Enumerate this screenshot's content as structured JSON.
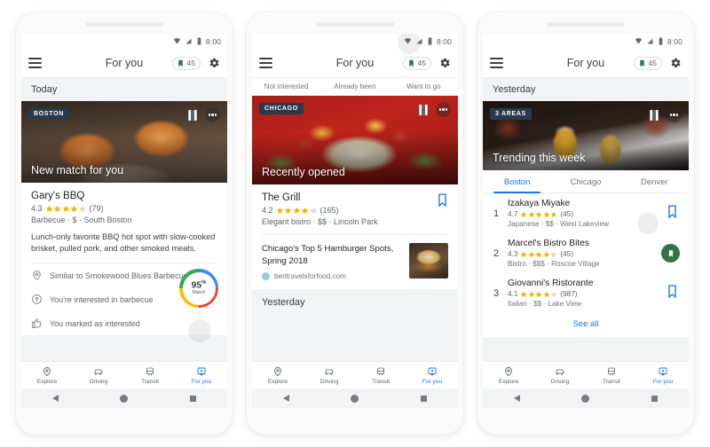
{
  "statusbar": {
    "time": "8:00",
    "icons": [
      "wifi-icon",
      "signal-icon",
      "battery-icon"
    ]
  },
  "appbar": {
    "title": "For you",
    "menu_icon": "hamburger-menu-icon",
    "saved_count": "45",
    "saved_icon": "bookmark-icon",
    "settings_icon": "gear-icon"
  },
  "colors": {
    "accent_blue": "#1a73e8",
    "saved_green": "#34734a",
    "chip_navy": "#2a3a4d",
    "star_gold": "#f5b400",
    "strip_gray": "#f1f3f4"
  },
  "bottom_nav": {
    "items": [
      {
        "label": "Explore",
        "icon": "explore-pin-icon",
        "active": false
      },
      {
        "label": "Driving",
        "icon": "car-icon",
        "active": false
      },
      {
        "label": "Transit",
        "icon": "train-icon",
        "active": false
      },
      {
        "label": "For you",
        "icon": "for-you-icon",
        "active": true
      }
    ]
  },
  "system_bar": {
    "back": "back-triangle-icon",
    "home": "home-circle-icon",
    "recents": "recents-square-icon"
  },
  "phone1": {
    "section_label": "Today",
    "hero": {
      "city_chip": "BOSTON",
      "title": "New match for you",
      "photo": "bbq-sandwiches-photo",
      "map_icon": "map-badge-icon",
      "overflow_icon": "more-options-icon"
    },
    "place": {
      "name": "Gary's BBQ",
      "rating": "4.3",
      "stars": 4.3,
      "review_count": "(79)",
      "meta": "Barbecue · $ · South Boston",
      "description": "Lunch-only favorite BBQ hot spot with slow-cooked brisket, pulled pork, and other smoked meats."
    },
    "reasons": [
      {
        "icon": "place-pin-icon",
        "text": "Similar to Smokewood Blues Barbecue"
      },
      {
        "icon": "interest-arrow-icon",
        "text": "You're interested in barbecue"
      },
      {
        "icon": "thumbs-up-icon",
        "text": "You marked as interested"
      }
    ],
    "match": {
      "percent": "95",
      "percent_symbol": "%",
      "label": "Match"
    }
  },
  "phone2": {
    "filters": [
      "Not interested",
      "Already been",
      "Want to go"
    ],
    "hero": {
      "city_chip": "CHICAGO",
      "title": "Recently opened",
      "photo": "grilled-chicken-salad-photo",
      "map_icon": "map-badge-icon",
      "overflow_icon": "more-options-icon"
    },
    "place": {
      "name": "The Grill",
      "rating": "4.2",
      "stars": 4.2,
      "review_count": "(165)",
      "meta": "Elegant bistro · $$ · Lincoln Park",
      "bookmark_icon": "bookmark-outline-icon"
    },
    "article": {
      "title": "Chicago's Top 5 Hamburger Spots, Spring 2018",
      "domain": "bentravelsforfood.com",
      "thumbnail": "hamburger-thumbnail",
      "favicon": "site-favicon"
    },
    "next_section_label": "Yesterday"
  },
  "phone3": {
    "section_label": "Yesterday",
    "hero": {
      "city_chip": "3 AREAS",
      "title": "Trending this week",
      "photo": "beer-cheers-photo",
      "map_icon": "map-badge-icon",
      "overflow_icon": "more-options-icon"
    },
    "tabs": [
      {
        "label": "Boston",
        "active": true
      },
      {
        "label": "Chicago",
        "active": false
      },
      {
        "label": "Denver",
        "active": false
      }
    ],
    "list": [
      {
        "rank": "1",
        "name": "Izakaya Miyake",
        "rating": "4.7",
        "stars": 4.7,
        "review_count": "(45)",
        "meta": "Japanese · $$ · West Lakeview",
        "bookmark_icon": "bookmark-outline-icon",
        "saved": false
      },
      {
        "rank": "2",
        "name": "Marcel's Bistro Bites",
        "rating": "4.3",
        "stars": 4.3,
        "review_count": "(45)",
        "meta": "Bistro · $$$ · Roscoe Village",
        "bookmark_icon": "bookmark-filled-icon",
        "saved": true
      },
      {
        "rank": "3",
        "name": "Giovanni's Ristorante",
        "rating": "4.1",
        "stars": 4.1,
        "review_count": "(987)",
        "meta": "Italian · $$ · Lake View",
        "bookmark_icon": "bookmark-outline-icon",
        "saved": false
      }
    ],
    "see_all": "See all"
  }
}
